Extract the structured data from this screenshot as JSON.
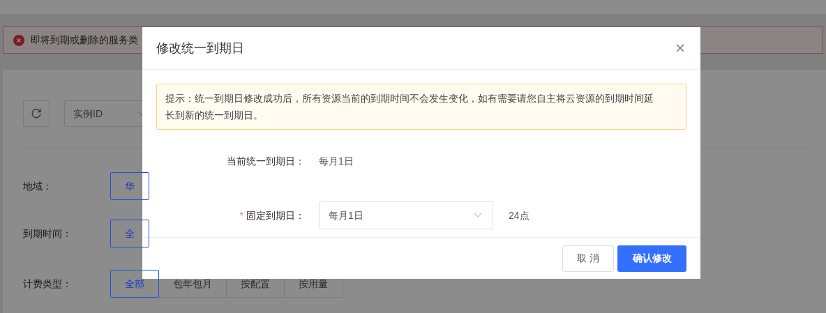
{
  "page": {
    "alert": {
      "text": "即将到期或删除的服务类"
    },
    "search": {
      "select_value": "实例ID"
    },
    "filters": [
      {
        "label": "地域：",
        "options": [
          {
            "label": "华",
            "selected": true
          }
        ]
      },
      {
        "label": "到期时间：",
        "options": [
          {
            "label": "全",
            "selected": true
          }
        ]
      },
      {
        "label": "计费类型：",
        "options": [
          {
            "label": "全部",
            "selected": true
          },
          {
            "label": "包年包月",
            "selected": false
          },
          {
            "label": "按配置",
            "selected": false
          },
          {
            "label": "按用量",
            "selected": false
          }
        ]
      }
    ]
  },
  "dialog": {
    "title": "修改统一到期日",
    "close": "×",
    "notice": "提示：统一到期日修改成功后，所有资源当前的到期时间不会发生变化，如有需要请您自主将云资源的到期时间延长到新的统一到期日。",
    "fields": [
      {
        "kind": "text",
        "label": "当前统一到期日：",
        "value": "每月1日"
      },
      {
        "kind": "select",
        "required_mark": "*",
        "label": "固定到期日：",
        "value": "每月1日",
        "suffix": "24点"
      }
    ],
    "buttons": [
      {
        "label": "取 消",
        "primary": false
      },
      {
        "label": "确认修改",
        "primary": true
      }
    ]
  }
}
